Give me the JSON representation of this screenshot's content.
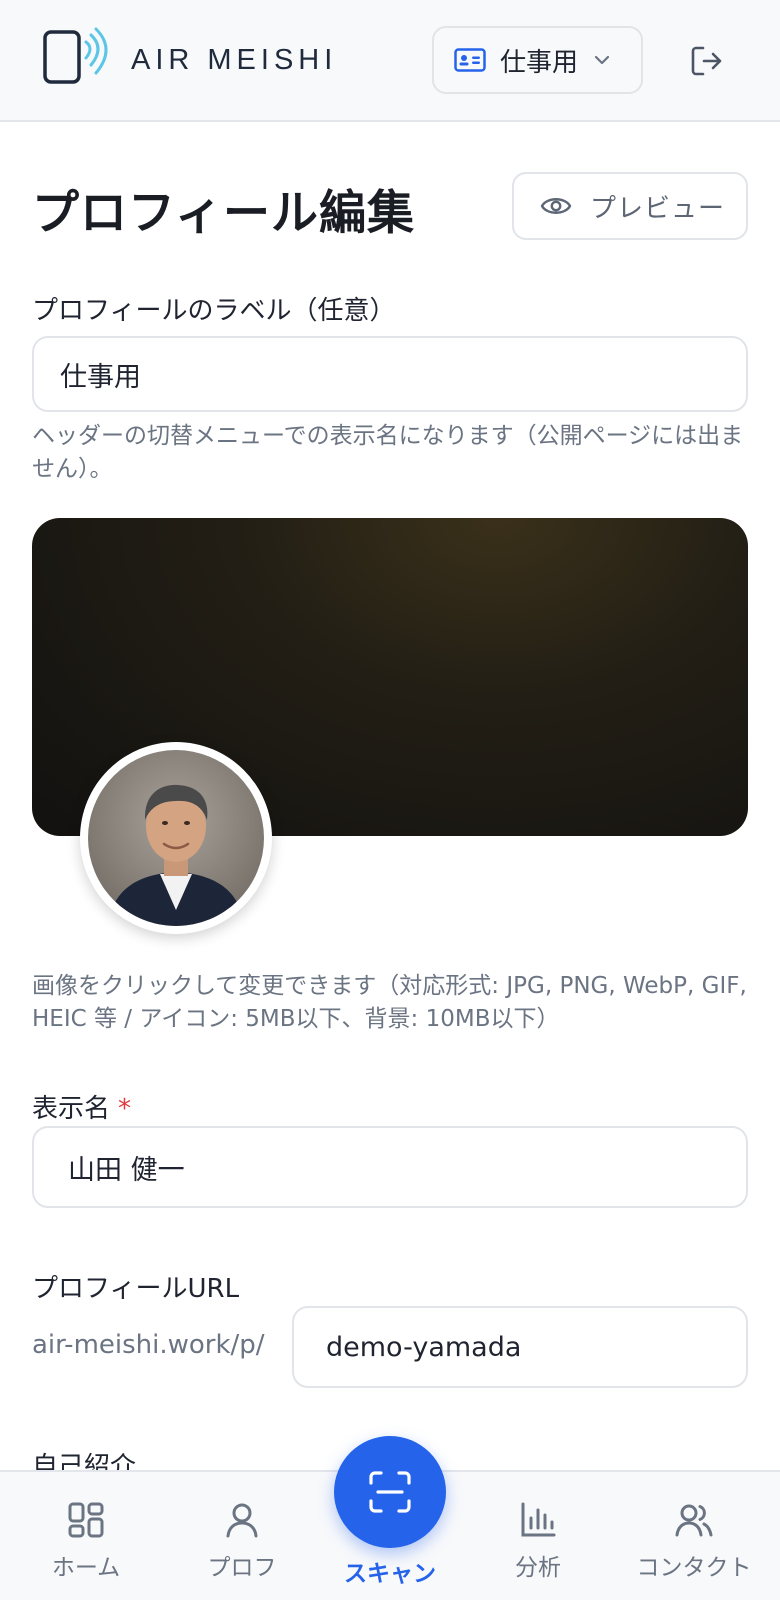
{
  "header": {
    "brand": "AIR MEISHI",
    "profile_switcher": "仕事用"
  },
  "page": {
    "title": "プロフィール編集",
    "preview_label": "プレビュー"
  },
  "form": {
    "profile_label": {
      "label": "プロフィールのラベル（任意）",
      "value": "仕事用",
      "hint": "ヘッダーの切替メニューでの表示名になります（公開ページには出ません）。"
    },
    "image_hint": "画像をクリックして変更できます（対応形式: JPG, PNG, WebP, GIF, HEIC 等 / アイコン: 5MB以下、背景: 10MB以下）",
    "display_name": {
      "label": "表示名",
      "required_mark": "*",
      "value": "山田 健一"
    },
    "profile_url": {
      "label": "プロフィールURL",
      "prefix": "air-meishi.work/p/",
      "value": "demo-yamada"
    },
    "bio_label": "自己紹介"
  },
  "bottom_nav": {
    "home": "ホーム",
    "profile": "プロフ",
    "scan": "スキャン",
    "analytics": "分析",
    "contacts": "コンタクト"
  },
  "colors": {
    "accent": "#2563eb",
    "required": "#e0393e",
    "logo_waves": "#5bc6e6"
  }
}
